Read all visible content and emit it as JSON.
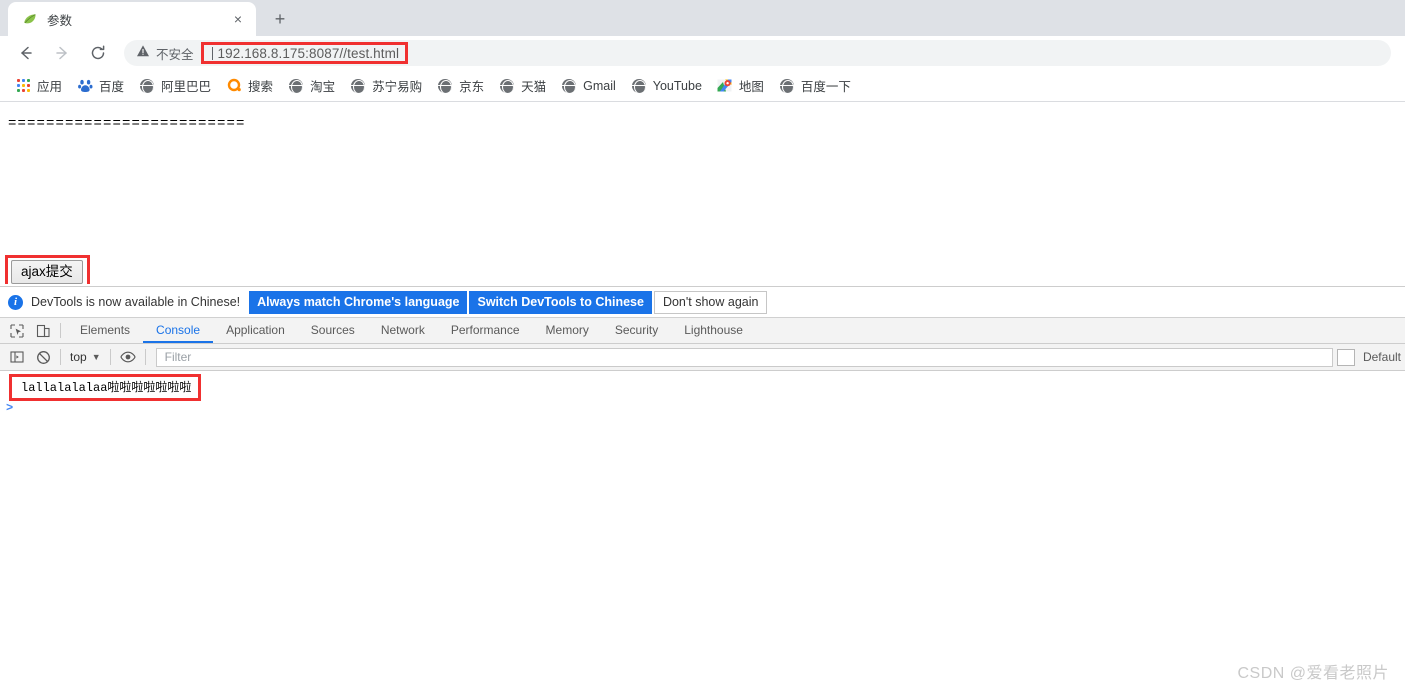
{
  "browser": {
    "tab": {
      "title": "参数",
      "favicon": "leaf-icon",
      "close_label": "×"
    },
    "new_tab_label": "+",
    "nav": {
      "back": "back-arrow-icon",
      "forward": "forward-arrow-icon",
      "reload": "reload-icon"
    },
    "omnibox": {
      "security_icon": "warning-triangle-icon",
      "security_text": "不安全",
      "url": "192.168.8.175:8087//test.html",
      "highlight_color": "#f03030"
    },
    "bookmarks": [
      {
        "label": "应用",
        "icon": "apps-grid-icon"
      },
      {
        "label": "百度",
        "icon": "baidu-paw-icon"
      },
      {
        "label": "阿里巴巴",
        "icon": "globe-icon"
      },
      {
        "label": "搜索",
        "icon": "orange-circle-icon"
      },
      {
        "label": "淘宝",
        "icon": "globe-icon"
      },
      {
        "label": "苏宁易购",
        "icon": "globe-icon"
      },
      {
        "label": "京东",
        "icon": "globe-icon"
      },
      {
        "label": "天猫",
        "icon": "globe-icon"
      },
      {
        "label": "Gmail",
        "icon": "globe-icon"
      },
      {
        "label": "YouTube",
        "icon": "globe-icon"
      },
      {
        "label": "地图",
        "icon": "maps-pin-icon"
      },
      {
        "label": "百度一下",
        "icon": "globe-icon"
      }
    ]
  },
  "page": {
    "separator": "=========================",
    "submit_button": "ajax提交"
  },
  "devtools": {
    "infobar": {
      "icon": "info-icon",
      "message": "DevTools is now available in Chinese!",
      "buttons": [
        "Always match Chrome's language",
        "Switch DevTools to Chinese",
        "Don't show again"
      ]
    },
    "icons": {
      "inspect": "inspect-element-icon",
      "device": "device-toolbar-icon"
    },
    "tabs": [
      "Elements",
      "Console",
      "Application",
      "Sources",
      "Network",
      "Performance",
      "Memory",
      "Security",
      "Lighthouse"
    ],
    "active_tab": "Console",
    "console_toolbar": {
      "sidebar_icon": "console-sidebar-icon",
      "clear_icon": "clear-console-icon",
      "context": "top",
      "context_caret": "▼",
      "eye_icon": "live-expression-icon",
      "filter_placeholder": "Filter",
      "levels_label": "Default"
    },
    "console_messages": [
      "lallalalalaa啦啦啦啦啦啦啦"
    ],
    "prompt": ">"
  },
  "watermark": "CSDN @爱看老照片"
}
